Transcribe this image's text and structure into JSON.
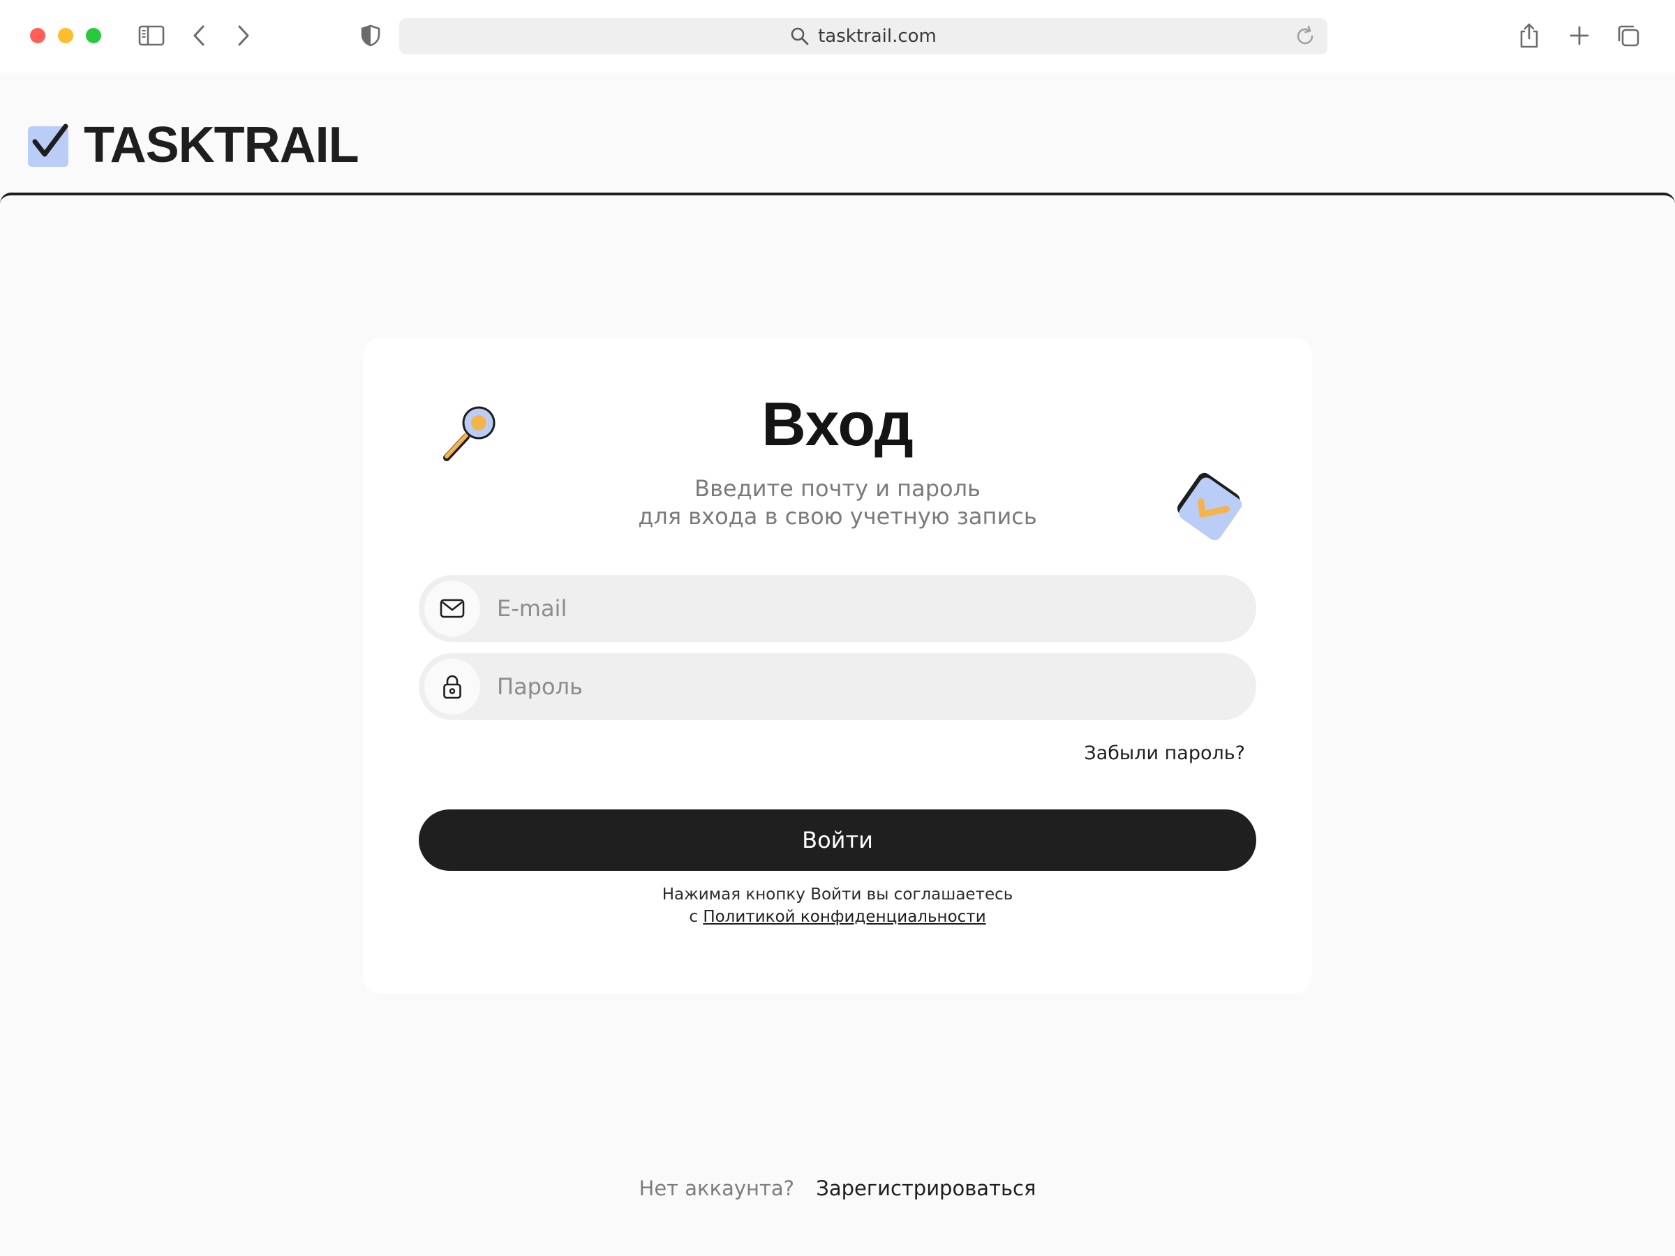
{
  "browser": {
    "url": "tasktrail.com"
  },
  "brand": {
    "name": "TASKTRAIL",
    "logo_accent": "#b9cdf7",
    "logo_ink": "#1e1e1e"
  },
  "login": {
    "title": "Вход",
    "subtitle_line1": "Введите почту и пароль",
    "subtitle_line2": "для входа в свою учетную запись",
    "email_placeholder": "E-mail",
    "password_placeholder": "Пароль",
    "forgot_label": "Забыли пароль?",
    "submit_label": "Войти",
    "terms_line1": "Нажимая кнопку Войти вы соглашаетесь",
    "terms_prefix": "с",
    "terms_link": "Политикой конфиденциальности"
  },
  "signup": {
    "question": "Нет аккаунта?",
    "link": "Зарегистрироваться"
  },
  "colors": {
    "page_bg": "#fafafa",
    "card_bg": "#ffffff",
    "field_bg": "#efefef",
    "button_bg": "#1f1f1f",
    "accent_blue": "#b9cdf7",
    "accent_orange": "#f5b34a"
  },
  "icons": {
    "sidebar": "sidebar-icon",
    "back": "chevron-left-icon",
    "forward": "chevron-right-icon",
    "privacy": "shield-icon",
    "search": "search-icon",
    "reload": "reload-icon",
    "share": "share-icon",
    "new_tab": "plus-icon",
    "tabs": "tabs-icon",
    "email": "mail-icon",
    "password": "lock-icon"
  }
}
